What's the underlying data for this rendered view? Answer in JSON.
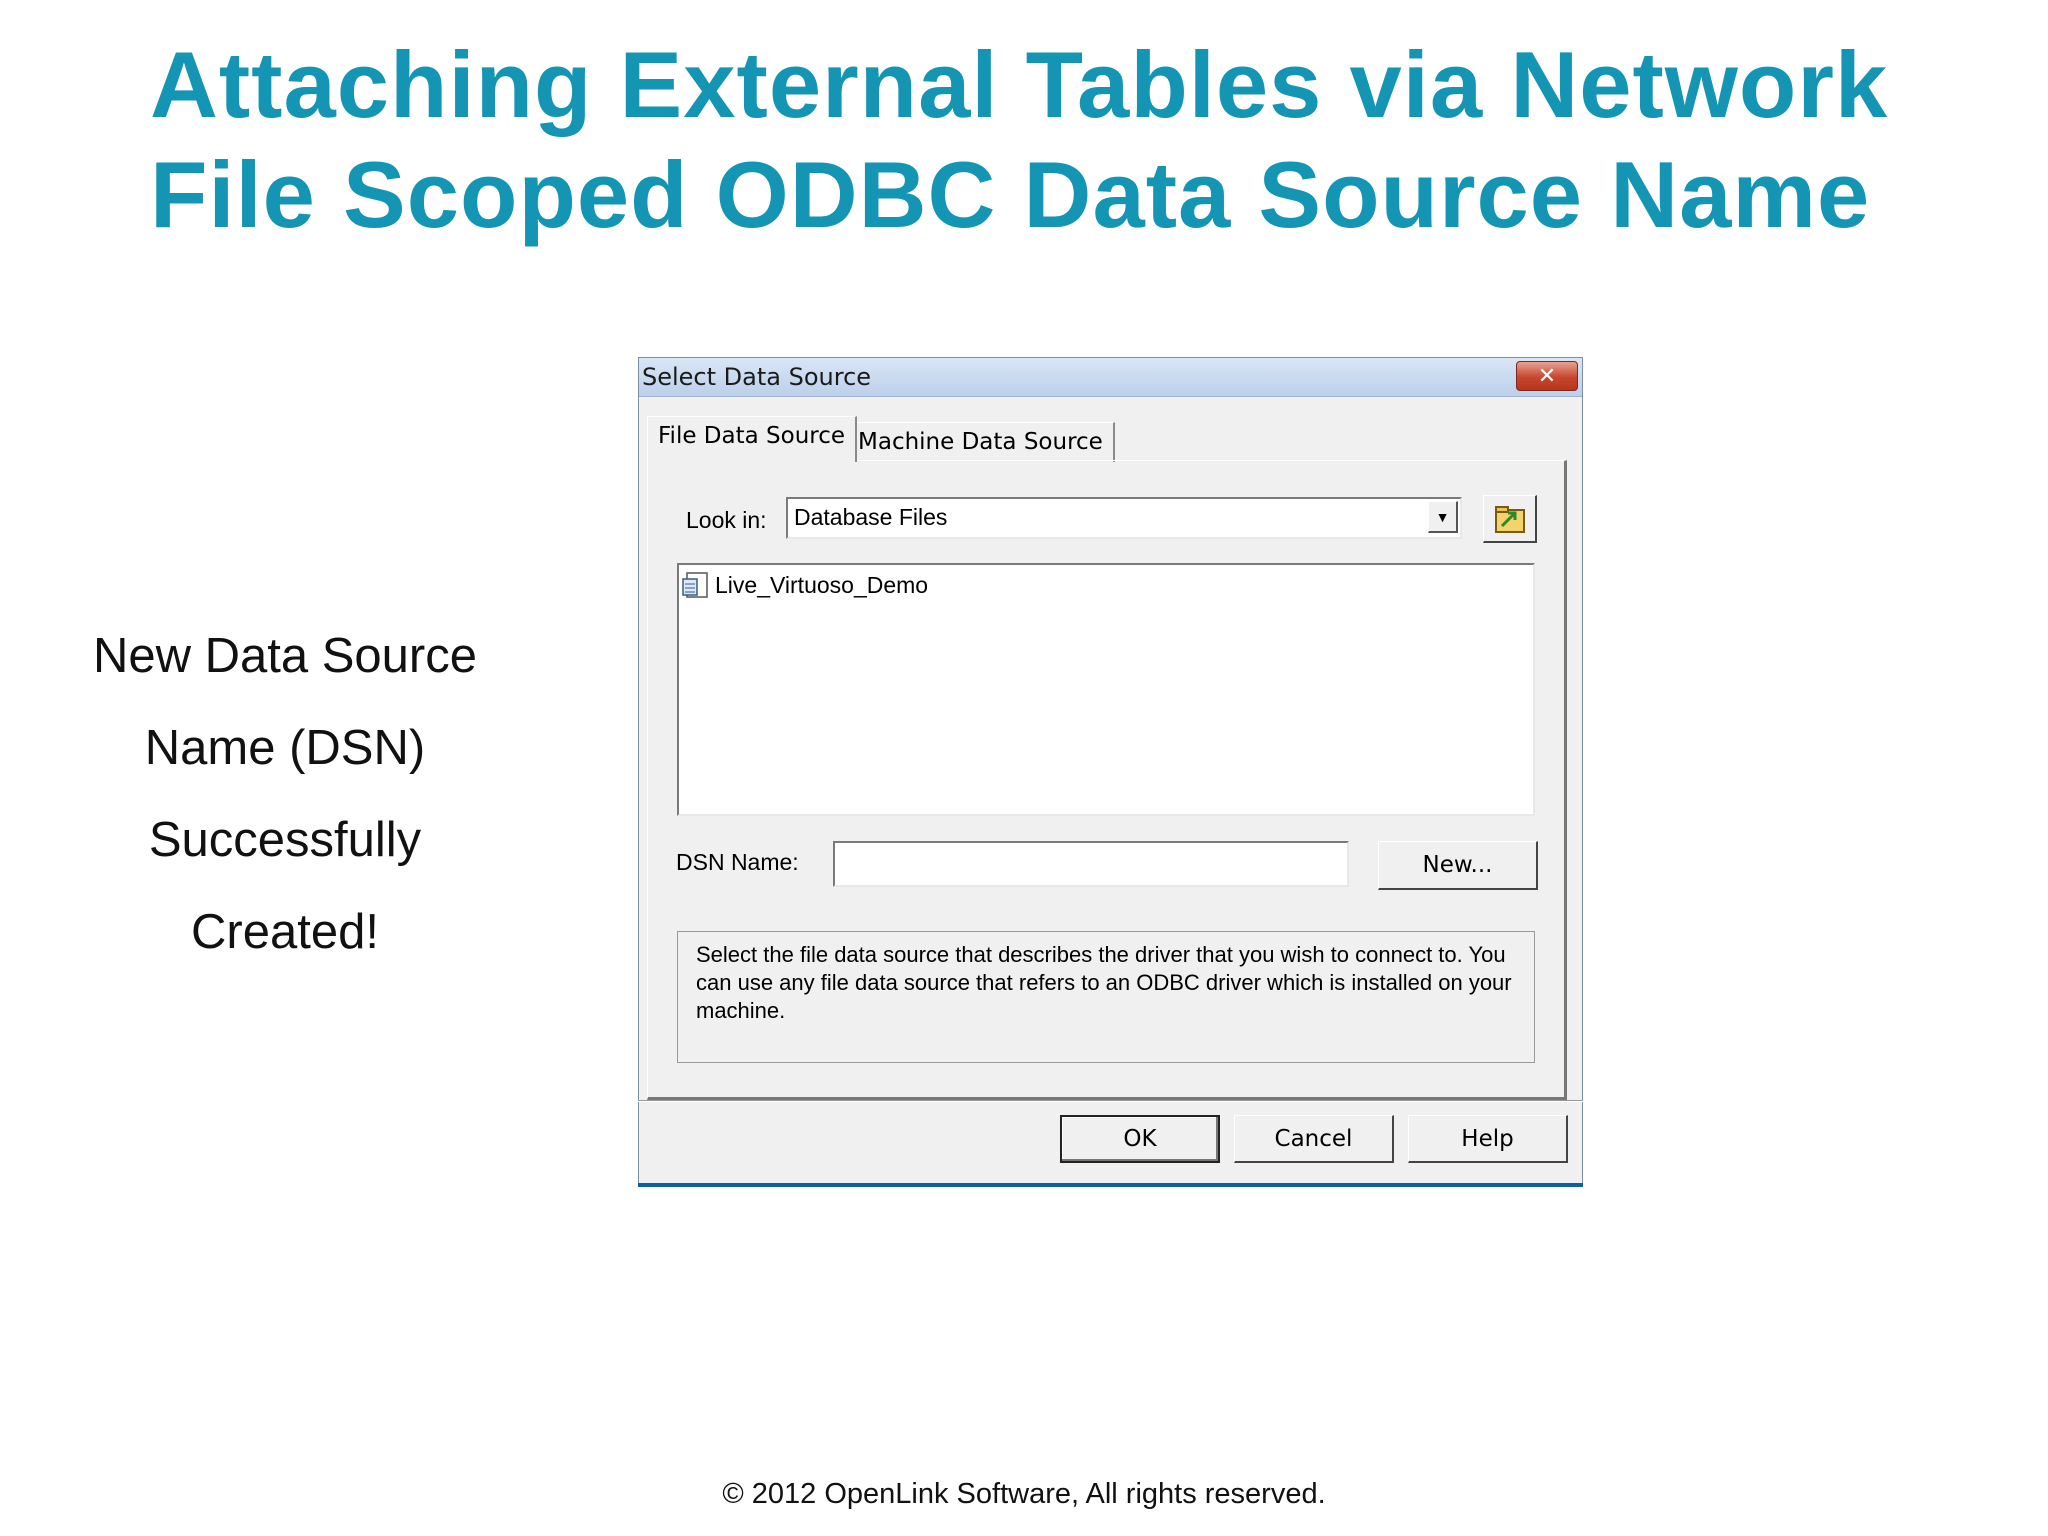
{
  "slide": {
    "title_line1": "Attaching External Tables via Network",
    "title_line2": "File Scoped ODBC Data Source Name",
    "caption_lines": [
      "New Data Source",
      "Name (DSN)",
      "Successfully",
      "Created!"
    ],
    "footer": "© 2012 OpenLink Software, All rights reserved.",
    "title_color": "#1595b4"
  },
  "dialog": {
    "title": "Select Data Source",
    "close_icon": "close-icon",
    "tabs": [
      {
        "label": "File Data Source",
        "active": true
      },
      {
        "label": "Machine Data Source",
        "active": false
      }
    ],
    "look_in_label": "Look in:",
    "look_in_value": "Database Files",
    "files": [
      {
        "name": "Live_Virtuoso_Demo",
        "icon": "dsn-file-icon"
      }
    ],
    "dsn_name_label": "DSN Name:",
    "dsn_name_value": "",
    "new_button": "New...",
    "description": "Select the file data source that describes the driver that you wish to connect to. You can use any file data source that refers to an ODBC driver which is installed on your machine.",
    "ok_button": "OK",
    "cancel_button": "Cancel",
    "help_button": "Help"
  }
}
